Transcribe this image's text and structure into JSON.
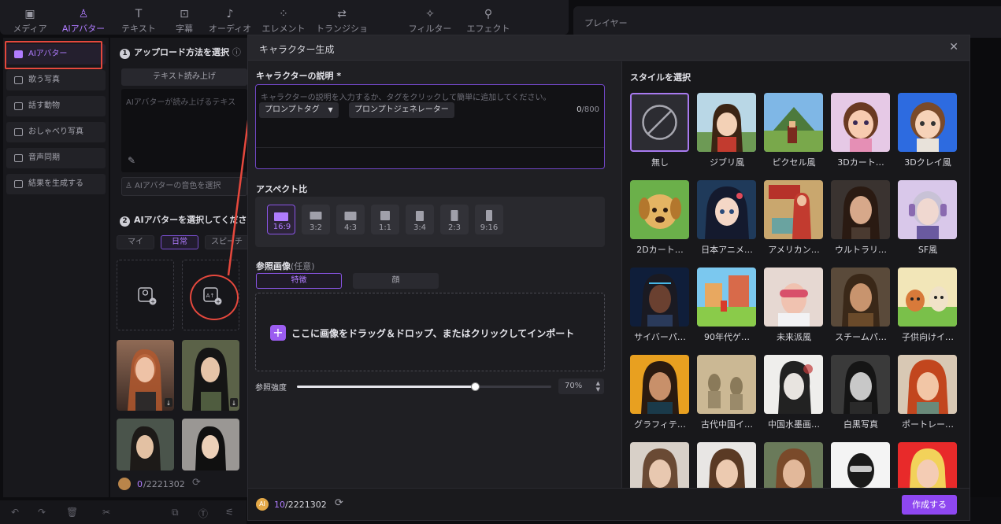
{
  "toolbar": {
    "tabs": [
      {
        "label": "メディア",
        "icon": "media-icon"
      },
      {
        "label": "AIアバター",
        "icon": "avatar-icon"
      },
      {
        "label": "テキスト",
        "icon": "text-icon"
      },
      {
        "label": "字幕",
        "icon": "caption-icon"
      },
      {
        "label": "オーディオ",
        "icon": "audio-icon"
      },
      {
        "label": "エレメント",
        "icon": "element-icon"
      },
      {
        "label": "トランジション",
        "icon": "transition-icon"
      },
      {
        "label": "フィルター",
        "icon": "filter-icon"
      },
      {
        "label": "エフェクト",
        "icon": "effect-icon"
      }
    ]
  },
  "player": {
    "title": "プレイヤー"
  },
  "sidebar": {
    "items": [
      {
        "label": "AIアバター"
      },
      {
        "label": "歌う写真"
      },
      {
        "label": "話す動物"
      },
      {
        "label": "おしゃべり写真"
      },
      {
        "label": "音声同期"
      },
      {
        "label": "結果を生成する"
      }
    ]
  },
  "midpanel": {
    "step1": "アップロード方法を選択",
    "read_button": "テキスト読み上げ",
    "read_placeholder": "AIアバターが読み上げるテキス",
    "voice_button": "AIアバターの音色を選択",
    "step2": "AIアバターを選択してくださ",
    "subtabs": [
      "マイ",
      "日常",
      "スピーチ"
    ],
    "credits_used": "0",
    "credits_total": "/2221302"
  },
  "modal": {
    "title": "キャラクター生成",
    "desc_label": "キャラクターの説明 *",
    "desc_placeholder": "キャラクターの説明を入力するか、タグをクリックして簡単に追加してください。",
    "prompt_tag": "プロンプトタグ",
    "prompt_gen": "プロンプトジェネレーター",
    "char_count": "0",
    "char_max": "/800",
    "aspect_label": "アスペクト比",
    "aspect_ratios": [
      "16:9",
      "3:2",
      "4:3",
      "1:1",
      "3:4",
      "2:3",
      "9:16"
    ],
    "selected_aspect": "16:9",
    "ref_label": "参照画像",
    "ref_optional": "(任意)",
    "ref_tabs": [
      "特徴",
      "顔"
    ],
    "dropzone_text": "ここに画像をドラッグ＆ドロップ、またはクリックしてインポート",
    "strength_label": "参照強度",
    "strength_value": "70%",
    "strength_fraction": 0.7,
    "style_label": "スタイルを選択",
    "styles": [
      "無し",
      "ジブリ風",
      "ピクセル風",
      "3Dカート…",
      "3Dクレイ風",
      "2Dカート…",
      "日本アニメ…",
      "アメリカン…",
      "ウルトラリ…",
      "SF風",
      "サイバーパ…",
      "90年代ゲ…",
      "未来派風",
      "スチームパ…",
      "子供向けイ…",
      "グラフィテ…",
      "古代中国イ…",
      "中国水墨画…",
      "白黒写真",
      "ポートレー…",
      "",
      "",
      "",
      "",
      ""
    ],
    "credits_used": "10",
    "credits_total": "/2221302",
    "generate_button": "作成する",
    "coin_label": "AI"
  },
  "colors": {
    "accent": "#8e47f0",
    "annotation": "#e5483d"
  }
}
